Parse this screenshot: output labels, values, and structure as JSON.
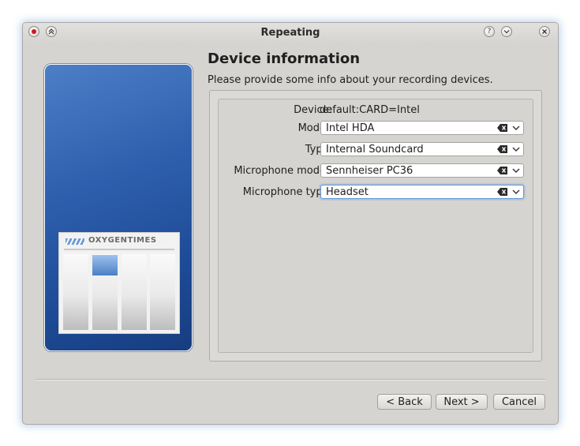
{
  "window": {
    "title": "Repeating",
    "help_glyph": "?",
    "shade_glyph": "⌃",
    "menu_glyph": "⌄",
    "close_glyph": "⊗"
  },
  "side_panel": {
    "newspaper_title": "OXYGENTIMES"
  },
  "page": {
    "heading": "Device information",
    "subheading": "Please provide some info about your recording devices."
  },
  "form": {
    "device_label": "Device:",
    "device_value": "default:CARD=Intel",
    "model_label": "Model:",
    "model_value": "Intel HDA",
    "type_label": "Type:",
    "type_value": "Internal Soundcard",
    "mic_model_label": "Microphone model:",
    "mic_model_value": "Sennheiser PC36",
    "mic_type_label": "Microphone type:",
    "mic_type_value": "Headset"
  },
  "buttons": {
    "back": "< Back",
    "next": "Next >",
    "cancel": "Cancel"
  },
  "colors": {
    "window_bg": "#d6d4d1",
    "side_panel_blue": "#2e5fae",
    "focus_ring": "#6a9ad2",
    "close_red": "#d01818"
  }
}
